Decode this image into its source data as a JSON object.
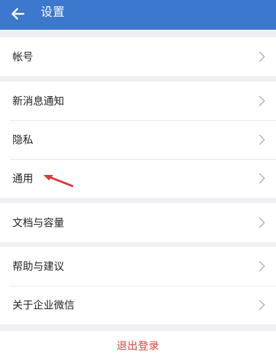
{
  "header": {
    "title": "设置",
    "back_icon": "back-arrow-icon",
    "background_color": "#3d78cf"
  },
  "groups": [
    {
      "items": [
        {
          "label": "帐号"
        }
      ]
    },
    {
      "items": [
        {
          "label": "新消息通知"
        },
        {
          "label": "隐私"
        },
        {
          "label": "通用"
        }
      ]
    },
    {
      "items": [
        {
          "label": "文档与容量"
        }
      ]
    },
    {
      "items": [
        {
          "label": "帮助与建议"
        },
        {
          "label": "关于企业微信"
        }
      ]
    }
  ],
  "logout": {
    "label": "退出登录",
    "color": "#e0433f"
  },
  "annotation": {
    "arrow_color": "#d93a35"
  }
}
